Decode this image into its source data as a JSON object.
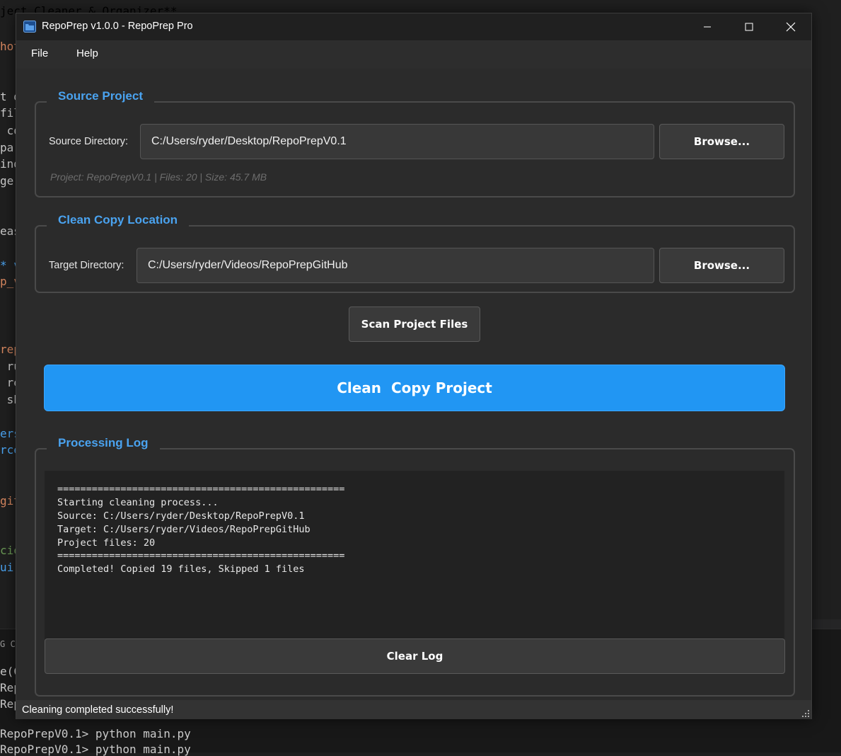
{
  "window": {
    "title": "RepoPrep v1.0.0 - RepoPrep Pro",
    "controls": {
      "minimize": "minimize-icon",
      "maximize": "maximize-icon",
      "close": "close-icon"
    }
  },
  "menu": {
    "file": "File",
    "help": "Help"
  },
  "source": {
    "group_title": "Source Project",
    "label": "Source Directory:",
    "path": "C:/Users/ryder/Desktop/RepoPrepV0.1",
    "browse": "Browse...",
    "info": "Project: RepoPrepV0.1 | Files: 20 | Size: 45.7 MB"
  },
  "target": {
    "group_title": "Clean Copy Location",
    "label": "Target Directory:",
    "path": "C:/Users/ryder/Videos/RepoPrepGitHub",
    "browse": "Browse..."
  },
  "actions": {
    "scan": "Scan Project Files",
    "clean": "Clean  Copy Project"
  },
  "log": {
    "group_title": "Processing Log",
    "lines": [
      "==================================================",
      "Starting cleaning process...",
      "Source: C:/Users/ryder/Desktop/RepoPrepV0.1",
      "Target: C:/Users/ryder/Videos/RepoPrepGitHub",
      "Project files: 20",
      "==================================================",
      "Completed! Copied 19 files, Skipped 1 files"
    ],
    "clear": "Clear Log"
  },
  "status": "Cleaning completed successfully!",
  "colors": {
    "accent": "#2196f3",
    "group_title": "#4aa3f0"
  },
  "background": {
    "editor_fragments": [
      {
        "text": "ject Cleaner & Organizer**",
        "color": "#4aa3f0"
      },
      {
        "text": "hot",
        "color": "#d7875f"
      },
      {
        "text": "t d",
        "color": "#cccccc"
      },
      {
        "text": "fil",
        "color": "#cccccc"
      },
      {
        "text": " co",
        "color": "#cccccc"
      },
      {
        "text": "par",
        "color": "#cccccc"
      },
      {
        "text": "ind",
        "color": "#cccccc"
      },
      {
        "text": "ge",
        "color": "#cccccc"
      },
      {
        "text": "eas",
        "color": "#cccccc"
      },
      {
        "text": "* v",
        "color": "#4aa3f0"
      },
      {
        "text": "p_v",
        "color": "#d7875f"
      },
      {
        "text": "rep",
        "color": "#d7875f"
      },
      {
        "text": " ru",
        "color": "#cccccc"
      },
      {
        "text": " re",
        "color": "#cccccc"
      },
      {
        "text": " sh",
        "color": "#cccccc"
      },
      {
        "text": "ers",
        "color": "#4aa3f0"
      },
      {
        "text": "rce",
        "color": "#4aa3f0"
      },
      {
        "text": "git",
        "color": "#d7875f"
      },
      {
        "text": "cie",
        "color": "#6a9955"
      },
      {
        "text": "uir",
        "color": "#4aa3f0"
      }
    ],
    "terminal_lines": [
      {
        "text": "G C",
        "color": "#999999"
      },
      {
        "text": "e(C",
        "color": "#cccccc"
      },
      {
        "text": "Rep",
        "color": "#cccccc"
      },
      {
        "text": "Rep",
        "color": "#cccccc"
      },
      {
        "text": "RepoPrepV0.1> python main.py",
        "color": "#cccccc"
      },
      {
        "text": "RepoPrepV0.1> python main.py",
        "color": "#cccccc"
      }
    ]
  }
}
